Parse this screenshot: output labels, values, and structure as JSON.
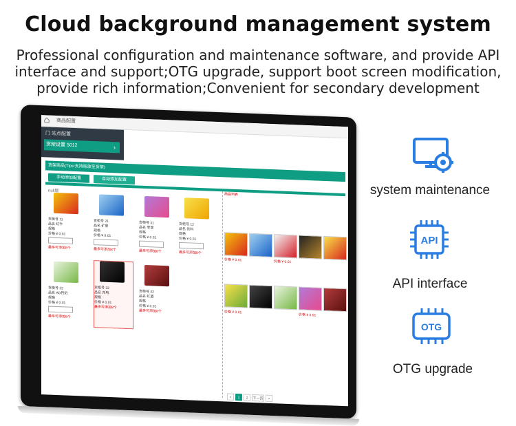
{
  "header": {
    "title": "Cloud background management system",
    "subtitle_lines": [
      "Professional configuration and maintenance software, and provide API",
      "interface and support;OTG upgrade, support boot screen modification,",
      "provide rich information;Convenient for secondary development"
    ]
  },
  "features": [
    {
      "icon": "monitor-gear-icon",
      "label": "system maintenance"
    },
    {
      "icon": "api-chip-icon",
      "label": "API interface"
    },
    {
      "icon": "otg-chip-icon",
      "label": "OTG upgrade"
    }
  ],
  "screen": {
    "tab_home": "商品配置",
    "sidebar_head": "门 站点配置",
    "sidebar_item": "货架设置 5012",
    "greenbar": "货架商品(Tips:支持拖放至货架)",
    "btn_manual": "手动添加配置",
    "btn_auto": "自动添加配置",
    "null_label": "null层",
    "right_label": "商品列表",
    "cards": [
      {
        "line1": "货柜号 11",
        "line2": "品名 红牛",
        "line3": "规格",
        "price": "价格 ¥ 0.01",
        "note": "最多可添加8个"
      },
      {
        "line1": "货柜号 21",
        "line2": "品名 矿泉",
        "line3": "规格",
        "price": "价格 ¥ 0.01",
        "note": "最多可添加8个"
      },
      {
        "line1": "货柜号 31",
        "line2": "品名 零食",
        "line3": "规格",
        "price": "价格 ¥ 0.01",
        "note": "最多可添加8个"
      },
      {
        "line1": "货柜号 12",
        "line2": "品名 饮料",
        "line3": "规格",
        "price": "价格 ¥ 0.01",
        "note": "最多可添加8个"
      },
      {
        "line1": "货柜号 22",
        "line2": "品名 AD钙奶",
        "line3": "规格",
        "price": "价格 ¥ 0.01",
        "note": "最多可添加8个"
      },
      {
        "line1": "货柜号 32",
        "line2": "品名 充电",
        "line3": "规格",
        "price": "价格 ¥ 0.01",
        "note": "最多可添加8个"
      },
      {
        "line1": "货柜号 42",
        "line2": "品名 红酒",
        "line3": "规格",
        "price": "价格 ¥ 0.01",
        "note": "最多可添加8个"
      }
    ],
    "grid_price": "价格 ¥ 0.01",
    "pager": [
      "<",
      "1",
      "2",
      "下一页",
      ">"
    ],
    "colors": {
      "accent": "#0f9d83",
      "bezel": "#111111",
      "icon_blue": "#2a7de1"
    }
  }
}
